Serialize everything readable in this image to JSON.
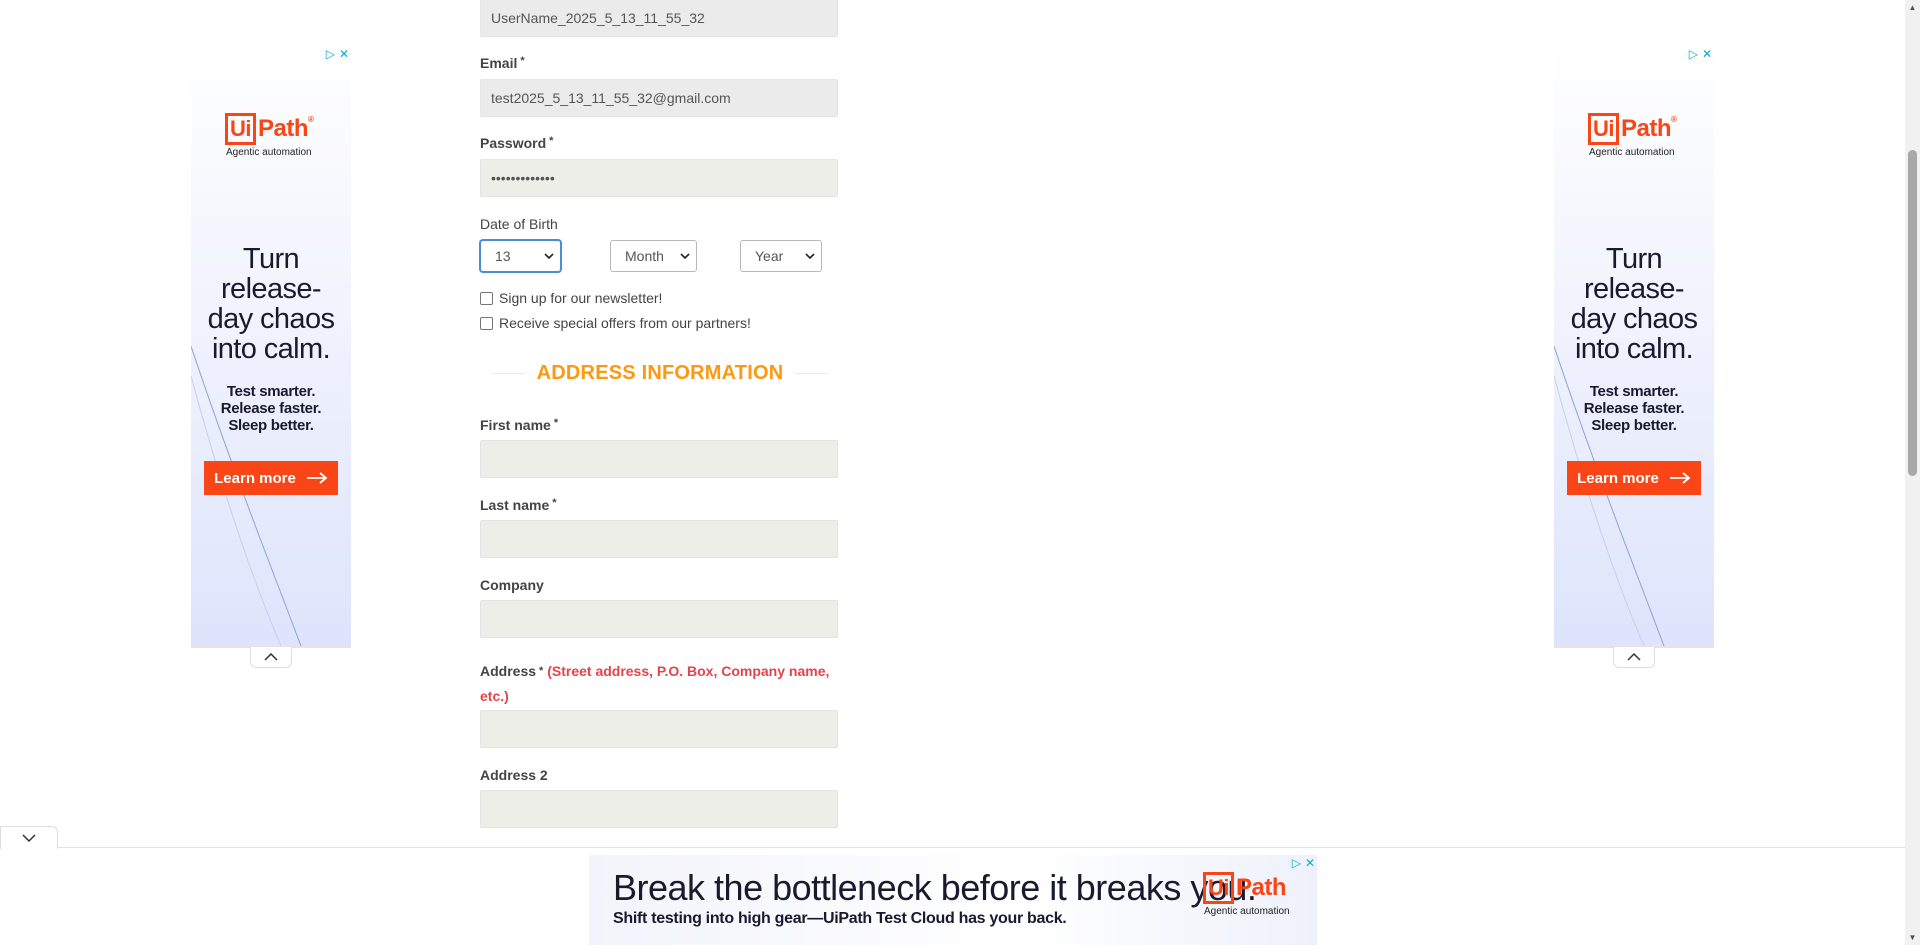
{
  "form": {
    "username_value": "UserName_2025_5_13_11_55_32",
    "email_label": "Email",
    "email_value": "test2025_5_13_11_55_32@gmail.com",
    "password_label": "Password",
    "password_value": "•••••••••••••",
    "required_mark": "*",
    "dob_label": "Date of Birth",
    "dob_day": "13",
    "dob_month": "Month",
    "dob_year": "Year",
    "newsletter_label": "Sign up for our newsletter!",
    "offers_label": "Receive special offers from our partners!",
    "address_section_title": "ADDRESS INFORMATION",
    "first_name_label": "First name",
    "last_name_label": "Last name",
    "company_label": "Company",
    "address_label": "Address",
    "address_hint": "(Street address, P.O. Box, Company name, etc.)",
    "address2_label": "Address 2"
  },
  "side_ad": {
    "logo_ui": "Ui",
    "logo_path": "Path",
    "logo_reg": "®",
    "logo_sub": "Agentic automation",
    "headline_1": "Turn",
    "headline_2": "release-",
    "headline_3": "day chaos",
    "headline_4": "into calm.",
    "sub_1": "Test smarter.",
    "sub_2": "Release faster.",
    "sub_3": "Sleep better.",
    "cta": "Learn more"
  },
  "bottom_ad": {
    "headline": "Break the bottleneck before it breaks you.",
    "subline": "Shift testing into high gear—UiPath Test Cloud has your back.",
    "logo_ui": "Ui",
    "logo_path": "Path",
    "logo_sub": "Agentic automation"
  },
  "icons": {
    "ad_choices": "▷",
    "ad_close": "✕",
    "scroll_up": "▲",
    "scroll_down": "▼"
  },
  "colors": {
    "section_title": "#fe980f",
    "brand_orange": "#fa4616",
    "hint_red": "#e4434b",
    "adchoice_blue": "#00aecd"
  }
}
